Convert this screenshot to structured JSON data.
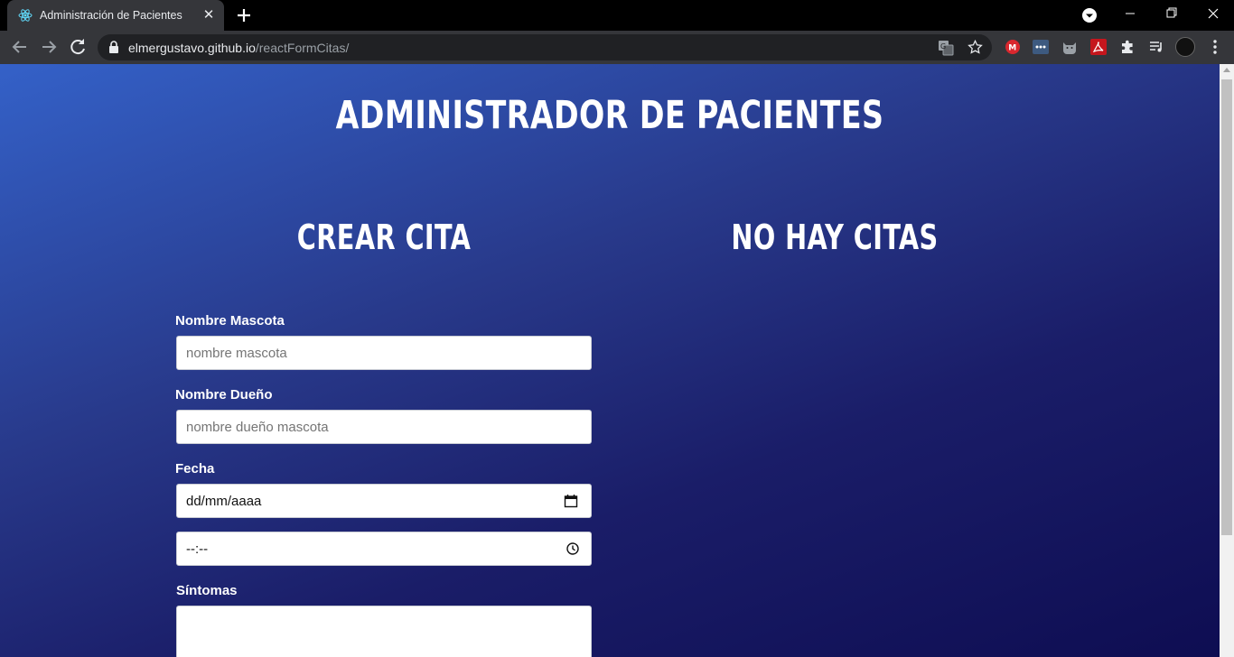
{
  "browser": {
    "tab_title": "Administración de Pacientes",
    "url_host": "elmergustavo.github.io",
    "url_path": "/reactFormCitas/",
    "icons": {
      "favicon": "react-icon",
      "new_tab": "plus-icon",
      "close_tab": "close-icon",
      "back": "arrow-left-icon",
      "forward": "arrow-right-icon",
      "reload": "reload-icon",
      "secure": "lock-icon",
      "translate": "translate-icon",
      "bookmark": "star-icon",
      "extensions": [
        "mega-extension-icon",
        "dots-extension-icon",
        "cat-extension-icon",
        "pdf-extension-icon",
        "puzzle-icon",
        "media-control-icon"
      ],
      "menu": "kebab-menu-icon"
    }
  },
  "app": {
    "title": "Administrador de Pacientes",
    "form_heading": "Crear Cita",
    "list_heading": "No hay citas",
    "form": {
      "pet_name_label": "Nombre Mascota",
      "pet_name_placeholder": "nombre mascota",
      "owner_label": "Nombre Dueño",
      "owner_placeholder": "nombre dueño mascota",
      "date_label": "Fecha",
      "date_value": "dd/mm/aaaa",
      "time_value": "--:--",
      "symptoms_label": "Síntomas"
    }
  },
  "colors": {
    "gradient_start": "#3461c8",
    "gradient_end": "#0e0d52",
    "heading_text": "#ffffff"
  }
}
